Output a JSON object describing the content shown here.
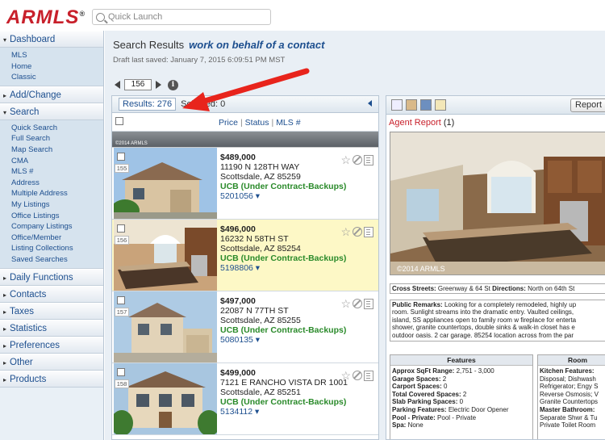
{
  "app": {
    "logo": "ARMLS",
    "logo_mark": "®",
    "quick_launch_placeholder": "Quick Launch"
  },
  "sidebar": [
    {
      "label": "Dashboard",
      "expanded": true,
      "items": [
        "MLS",
        "Home",
        "Classic"
      ]
    },
    {
      "label": "Add/Change",
      "expanded": false,
      "items": []
    },
    {
      "label": "Search",
      "expanded": true,
      "items": [
        "Quick Search",
        "Full Search",
        "Map Search",
        "CMA",
        "MLS #",
        "Address",
        "Multiple Address",
        "My Listings",
        "Office Listings",
        "Company Listings",
        "Office/Member",
        "Listing Collections",
        "Saved Searches"
      ]
    },
    {
      "label": "Daily Functions",
      "expanded": false,
      "items": []
    },
    {
      "label": "Contacts",
      "expanded": false,
      "items": []
    },
    {
      "label": "Taxes",
      "expanded": false,
      "items": []
    },
    {
      "label": "Statistics",
      "expanded": false,
      "items": []
    },
    {
      "label": "Preferences",
      "expanded": false,
      "items": []
    },
    {
      "label": "Other",
      "expanded": false,
      "items": []
    },
    {
      "label": "Products",
      "expanded": false,
      "items": []
    }
  ],
  "main": {
    "title": "Search Results",
    "context_link": "work on behalf of a contact",
    "draft_saved": "Draft last saved: January 7, 2015 6:09:51 PM MST",
    "page_value": "156",
    "results_count": "Results: 276",
    "selected": "Selected: 0",
    "columns": {
      "price": "Price",
      "status": "Status",
      "mls": "MLS #"
    },
    "strip_caption": "©2014 ARMLS"
  },
  "listings": [
    {
      "num": "155",
      "price": "$489,000",
      "address": "11190 N 128TH WAY",
      "city": "Scottsdale, AZ 85259",
      "status": "UCB (Under Contract-Backups)",
      "mls": "5201056",
      "highlighted": false
    },
    {
      "num": "156",
      "price": "$496,000",
      "address": "16232 N 58TH ST",
      "city": "Scottsdale, AZ 85254",
      "status": "UCB (Under Contract-Backups)",
      "mls": "5198806",
      "highlighted": true
    },
    {
      "num": "157",
      "price": "$497,000",
      "address": "22087 N 77TH ST",
      "city": "Scottsdale, AZ 85255",
      "status": "UCB (Under Contract-Backups)",
      "mls": "5080135",
      "highlighted": false
    },
    {
      "num": "158",
      "price": "$499,000",
      "address": "7121 E RANCHO VISTA DR 1001",
      "city": "Scottsdale, AZ 85251",
      "status": "UCB (Under Contract-Backups)",
      "mls": "5134112",
      "highlighted": false
    }
  ],
  "report": {
    "button": "Report",
    "agent_report": "Agent Report",
    "agent_count": "(1)",
    "photo_caption": "©2014 ARMLS",
    "cross_streets_label": "Cross Streets:",
    "cross_streets": "Greenway & 64 St",
    "directions_label": "Directions:",
    "directions": "North on 64th St",
    "remarks_label": "Public Remarks:",
    "remarks_lines": [
      "Looking for a completely remodeled, highly up",
      "room. Sunlight streams into the dramatic entry. Vaulted ceilings,",
      "island, SS appliances open to family room w fireplace for enterta",
      "shower, granite countertops, double sinks & walk-in closet has e",
      "outdoor oasis. 2 car garage. 85254 location across from the par"
    ],
    "features_title": "Features",
    "features": [
      {
        "k": "Approx SqFt Range:",
        "v": "2,751 - 3,000"
      },
      {
        "k": "Garage Spaces:",
        "v": "2"
      },
      {
        "k": "Carport Spaces:",
        "v": "0"
      },
      {
        "k": "Total Covered Spaces:",
        "v": "2"
      },
      {
        "k": "Slab Parking Spaces:",
        "v": "0"
      },
      {
        "k": "Parking Features:",
        "v": "Electric Door Opener"
      },
      {
        "k": "Pool - Private:",
        "v": "Pool - Private"
      },
      {
        "k": "Spa:",
        "v": "None"
      }
    ],
    "rooms_title": "Room",
    "rooms": [
      {
        "k": "Kitchen Features:",
        "v": ""
      },
      {
        "k": "",
        "v": "Disposal; Dishwash"
      },
      {
        "k": "",
        "v": "Refrigerator; Engy S"
      },
      {
        "k": "",
        "v": "Reverse Osmosis; V"
      },
      {
        "k": "",
        "v": "Granite Countertops"
      },
      {
        "k": "Master Bathroom:",
        "v": ""
      },
      {
        "k": "",
        "v": "Separate Shwr & Tu"
      },
      {
        "k": "",
        "v": "Private Toilet Room"
      }
    ]
  },
  "colors": {
    "brand": "#c8202b",
    "link": "#1d4f8f",
    "status": "#2a8a2a",
    "highlight": "#fdf8c6",
    "arrow": "#e8241c"
  }
}
